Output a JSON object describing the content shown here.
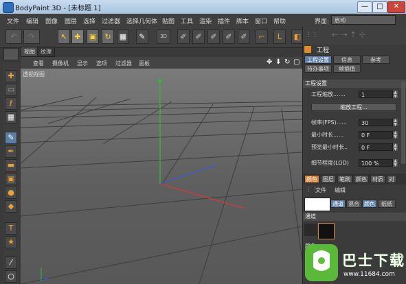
{
  "window": {
    "title": "BodyPaint 3D - [未标题 1]",
    "min": "—",
    "max": "□",
    "close": "✕"
  },
  "menu": [
    "文件",
    "编辑",
    "图像",
    "图层",
    "选择",
    "过滤器",
    "选择几何体",
    "贴图",
    "工具",
    "渲染",
    "插件",
    "脚本",
    "窗口",
    "帮助"
  ],
  "layout": {
    "label": "界面:",
    "value": "启动"
  },
  "toolbar_icons": [
    "undo-icon",
    "redo-icon",
    "move-arrow-icon",
    "move-icon",
    "scale-icon",
    "rotate-icon",
    "checker-icon",
    "paint-setup-icon",
    "bodypaint-3d-icon",
    "brush-icon",
    "brush-icon",
    "brush-icon",
    "brush-icon",
    "brush-icon",
    "uv-corner-icon",
    "cube-icon"
  ],
  "tool_icons": [
    "move-icon",
    "select-rect-icon",
    "lasso-icon",
    "checker-icon",
    "brush-icon",
    "pen-icon",
    "eraser-icon",
    "fill-icon",
    "drop-icon",
    "smudge-icon",
    "stamp-icon",
    "star-icon",
    "picker-icon",
    "sponge-icon"
  ],
  "tabs": [
    "视图",
    "纹理"
  ],
  "viewport_menu": [
    "查看",
    "摄像机",
    "显示",
    "选项",
    "过滤器",
    "面板"
  ],
  "viewport_label": "透视视图",
  "properties": {
    "header": "工程",
    "tabs_row1": [
      "工程设置",
      "信息",
      "参考"
    ],
    "tabs_row2": [
      "待办事项",
      "帧插值"
    ],
    "section": "工程设置",
    "scale_label": "工程缩放.......",
    "scale_value": "1",
    "scale_button": "缩放工程...",
    "rows": [
      {
        "label": "帧率(FPS)......",
        "value": "30"
      },
      {
        "label": "最小时长......",
        "value": "0 F"
      },
      {
        "label": "预览最小时长..",
        "value": "0 F"
      },
      {
        "label": "细节程度(LOD)",
        "value": "100 %"
      }
    ]
  },
  "color_panel": {
    "tabs": [
      "颜色",
      "图层",
      "笔刷",
      "颜色",
      "材质",
      "对"
    ],
    "menu": [
      "文件",
      "编辑"
    ],
    "channels": [
      "通道",
      "混合",
      "颜色",
      "纸纸"
    ],
    "section": "通道",
    "section2": "颜色"
  },
  "watermark": {
    "brand": "巴士下载",
    "url": "www.11684.com"
  },
  "colors": {
    "axis_y": "#2ebd3a",
    "axis_x": "#d23a3a",
    "axis_z": "#3a5bd2",
    "accent": "#5d7fa4"
  }
}
